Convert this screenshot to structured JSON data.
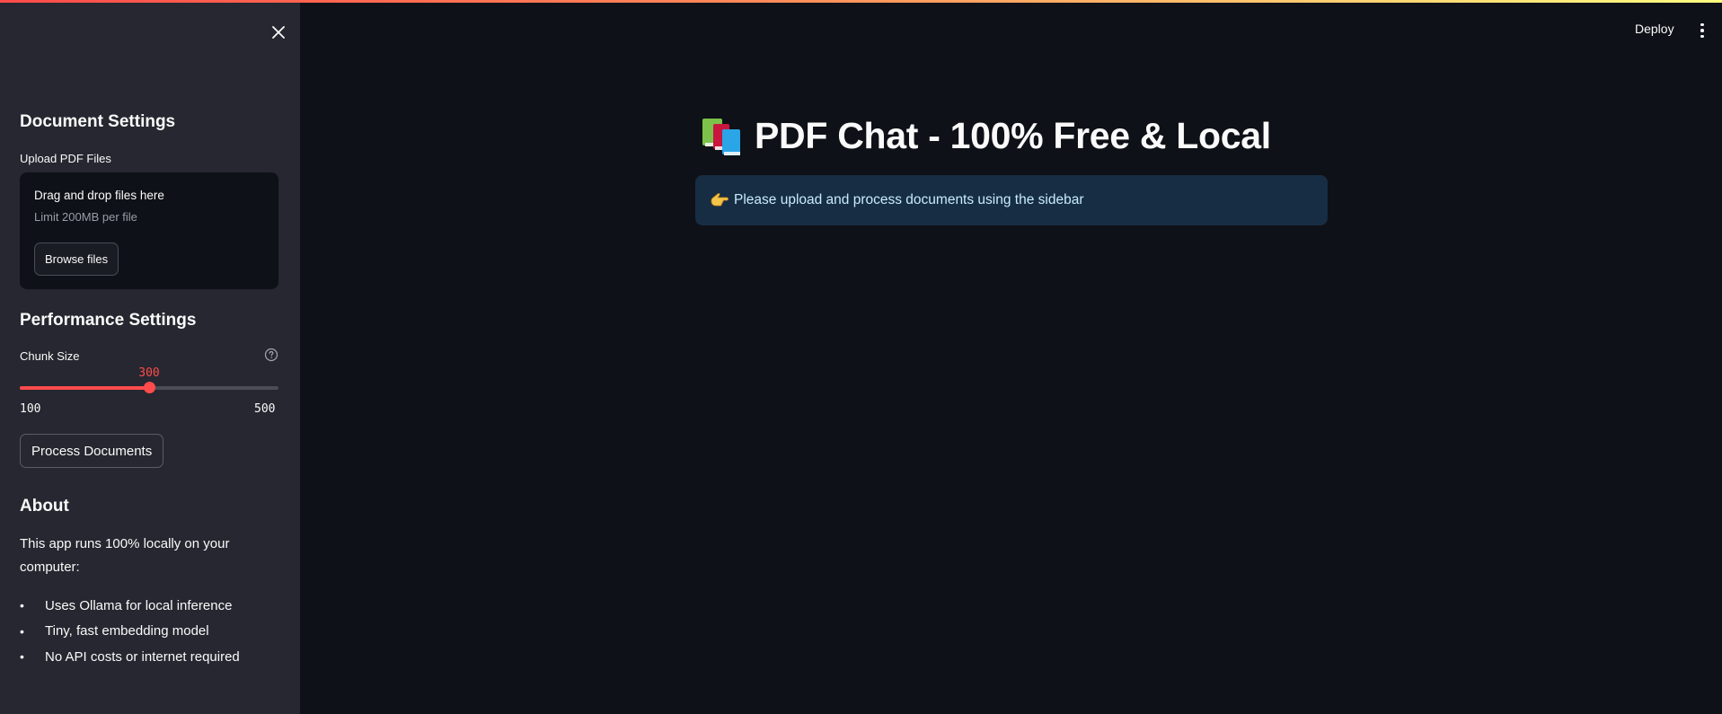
{
  "header": {
    "deploy_label": "Deploy",
    "menu_icon": "kebab-menu-icon"
  },
  "sidebar": {
    "close_icon": "close-icon",
    "document_settings_heading": "Document Settings",
    "upload_label": "Upload PDF Files",
    "dropzone_title": "Drag and drop files here",
    "dropzone_limit": "Limit 200MB per file",
    "browse_label": "Browse files",
    "performance_heading": "Performance Settings",
    "chunk_size_label": "Chunk Size",
    "help_icon": "help-circle-icon",
    "slider": {
      "value": "300",
      "min": "100",
      "max": "500"
    },
    "process_label": "Process Documents",
    "about_heading": "About",
    "about_text": "This app runs 100% locally on your computer:",
    "about_items": [
      "Uses Ollama for local inference",
      "Tiny, fast embedding model",
      "No API costs or internet required"
    ]
  },
  "main": {
    "title_icon": "books-emoji-icon",
    "title": "PDF Chat - 100% Free & Local",
    "info_icon": "pointing-hand-emoji-icon",
    "info_message": "Please upload and process documents using the sidebar"
  },
  "colors": {
    "accent": "#ff4b4b",
    "background": "#0e1117",
    "sidebar": "#262730",
    "info_background": "#172d43"
  }
}
